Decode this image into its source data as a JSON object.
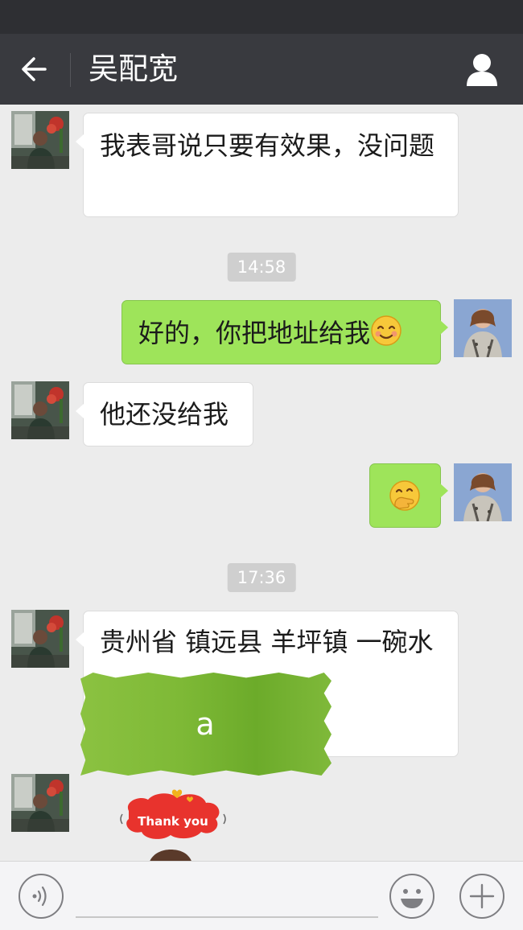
{
  "header": {
    "title": "吴配宽",
    "back_icon": "arrow-left-icon",
    "profile_icon": "person-icon"
  },
  "messages": [
    {
      "from": "contact",
      "text": "我表哥说只要有效果，没问题"
    },
    {
      "time": "14:58"
    },
    {
      "from": "me",
      "text": "好的，你把地址给我",
      "emoji": "smiling-face-icon"
    },
    {
      "from": "contact",
      "text": "他还没给我"
    },
    {
      "from": "me",
      "emoji": "hand-over-mouth-face-icon"
    },
    {
      "time": "17:36"
    },
    {
      "from": "contact",
      "text": "贵州省 镇远县 羊坪镇 一碗水",
      "partially_obscured": true
    },
    {
      "from": "contact",
      "sticker": "thank-you-sticker",
      "sticker_text": "Thank you"
    }
  ],
  "overlay": {
    "label": "a",
    "color": "#7eb936"
  },
  "input_bar": {
    "voice_icon": "voice-icon",
    "emoji_icon": "smiley-icon",
    "plus_icon": "plus-icon"
  },
  "colors": {
    "titlebar": "#393a3f",
    "statusbar": "#2e2f33",
    "chat_background": "#ececec",
    "incoming_bubble": "#ffffff",
    "outgoing_bubble": "#9ee45a",
    "timestamp_bg": "#cfcfcf"
  }
}
